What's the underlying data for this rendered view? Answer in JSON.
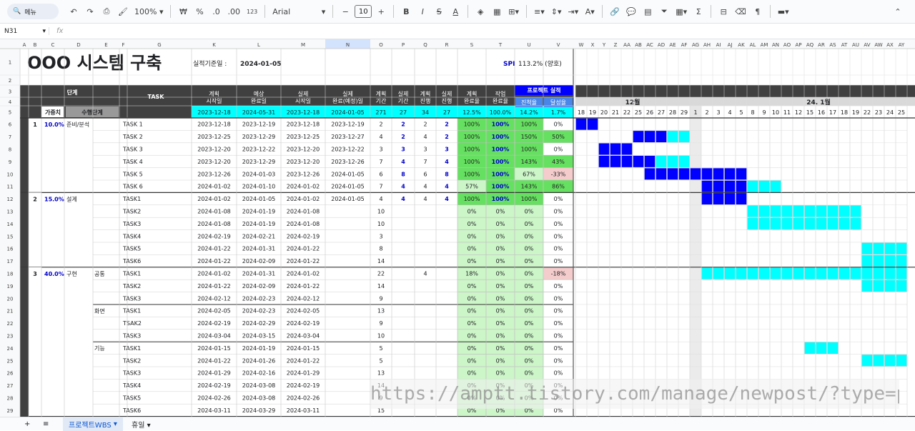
{
  "toolbar": {
    "menu_label": "메뉴",
    "zoom": "100%",
    "currency": "₩",
    "percent": "%",
    "dec_dec": ".0",
    "dec_inc": ".00",
    "number_format": "123",
    "font": "Arial",
    "font_size": "10"
  },
  "namebox": "N31",
  "fx": "fx",
  "title": {
    "main": "OOO 시스템 구축",
    "date_label": "실적기준일 :",
    "date_value": "2024-01-05",
    "spi_label": "SPI",
    "spi_value": "113.2% (양호)"
  },
  "colors": {
    "header_dark": "#404040",
    "cyan": "#00ffff",
    "blue": "#0000ff",
    "green_light": "#ccf5c8",
    "green": "#66e060",
    "pink": "#f4cccc",
    "col_sel": "#d3e3fd"
  },
  "col_letters_left": [
    "A",
    "B",
    "C",
    "D",
    "E",
    "F",
    "G",
    "K",
    "L",
    "M",
    "N",
    "O",
    "P",
    "Q",
    "R",
    "S",
    "T",
    "U",
    "V"
  ],
  "col_letters_right": [
    "W",
    "X",
    "Y",
    "Z",
    "AA",
    "AB",
    "AC",
    "AD",
    "AE",
    "AF",
    "AG",
    "AH",
    "AI",
    "AJ",
    "AK",
    "AL",
    "AM",
    "AN",
    "AO",
    "AP",
    "AQ",
    "AR",
    "AS",
    "AT",
    "AU",
    "AV",
    "AW",
    "AX",
    "AY"
  ],
  "headers": {
    "stage": "단계",
    "weight": "가중치",
    "exec_stage": "수행단계",
    "task": "TASK",
    "plan_start": "계획\n시작일",
    "exp_end": "예상\n완료일",
    "real_start": "실제\n시작일",
    "real_end": "실제\n완료(예정)일",
    "plan_period": "계획\n기간",
    "real_period": "실제\n기간",
    "plan_prog": "계획\n진행",
    "real_prog": "실제\n진행",
    "plan_rate": "계획\n완료율",
    "work_rate": "작업\n완료율",
    "project_perf": "프로젝트 실적",
    "progress_rate": "진척율",
    "achieve_rate": "달성율",
    "month_dec": "12월",
    "month_jan": "24. 1월"
  },
  "summary_row": [
    "2023-12-18",
    "2024-05-31",
    "2023-12-18",
    "2024-01-05",
    "271",
    "27",
    "34",
    "27",
    "12.5%",
    "100.0%",
    "14.2%",
    "1.7%"
  ],
  "days": [
    "18",
    "19",
    "20",
    "21",
    "22",
    "25",
    "26",
    "27",
    "28",
    "29",
    "1",
    "2",
    "3",
    "4",
    "5",
    "8",
    "9",
    "10",
    "11",
    "12",
    "15",
    "16",
    "17",
    "18",
    "19",
    "22",
    "23",
    "24",
    "25"
  ],
  "row_numbers": [
    "1",
    "2",
    "3",
    "4",
    "5",
    "6",
    "7",
    "8",
    "9",
    "10",
    "11",
    "12",
    "13",
    "14",
    "15",
    "16",
    "17",
    "18",
    "19",
    "20",
    "21",
    "22",
    "23",
    "24",
    "25",
    "26",
    "27",
    "28",
    "29"
  ],
  "groups": [
    {
      "num": "1",
      "weight": "10.0%",
      "name": "준비/분석",
      "rows": [
        0,
        5
      ]
    },
    {
      "num": "2",
      "weight": "15.0%",
      "name": "설계",
      "rows": [
        6,
        11
      ]
    },
    {
      "num": "3",
      "weight": "40.0%",
      "name": "구현",
      "rows": [
        12,
        23
      ]
    }
  ],
  "subgroups": [
    {
      "name": "공통",
      "rows": [
        12,
        14
      ]
    },
    {
      "name": "화면",
      "rows": [
        15,
        17
      ]
    },
    {
      "name": "기능",
      "rows": [
        18,
        23
      ]
    }
  ],
  "rows": [
    {
      "task": "TASK 1",
      "ps": "2023-12-18",
      "pe": "2023-12-19",
      "rs": "2023-12-18",
      "re": "2023-12-19",
      "pp": "2",
      "rp": "2",
      "pg": "2",
      "rg": "2",
      "pr": "100%",
      "wr": "100%",
      "prog": "100%",
      "ach": "0%",
      "gantt": [
        {
          "s": 0,
          "e": 2,
          "c": "b"
        }
      ]
    },
    {
      "task": "TASK 2",
      "ps": "2023-12-25",
      "pe": "2023-12-29",
      "rs": "2023-12-25",
      "re": "2023-12-27",
      "pp": "4",
      "rp": "2",
      "pg": "4",
      "rg": "2",
      "pr": "100%",
      "wr": "100%",
      "prog": "150%",
      "ach": "50%",
      "gantt": [
        {
          "s": 5,
          "e": 8,
          "c": "b"
        },
        {
          "s": 8,
          "e": 10,
          "c": "c"
        }
      ]
    },
    {
      "task": "TASK 3",
      "ps": "2023-12-20",
      "pe": "2023-12-22",
      "rs": "2023-12-20",
      "re": "2023-12-22",
      "pp": "3",
      "rp": "3",
      "pg": "3",
      "rg": "3",
      "pr": "100%",
      "wr": "100%",
      "prog": "100%",
      "ach": "0%",
      "gantt": [
        {
          "s": 2,
          "e": 5,
          "c": "b"
        }
      ]
    },
    {
      "task": "TASK 4",
      "ps": "2023-12-20",
      "pe": "2023-12-29",
      "rs": "2023-12-20",
      "re": "2023-12-26",
      "pp": "7",
      "rp": "4",
      "pg": "7",
      "rg": "4",
      "pr": "100%",
      "wr": "100%",
      "prog": "143%",
      "ach": "43%",
      "gantt": [
        {
          "s": 2,
          "e": 7,
          "c": "b"
        },
        {
          "s": 7,
          "e": 10,
          "c": "c"
        }
      ]
    },
    {
      "task": "TASK 5",
      "ps": "2023-12-26",
      "pe": "2024-01-03",
      "rs": "2023-12-26",
      "re": "2024-01-05",
      "pp": "6",
      "rp": "8",
      "pg": "6",
      "rg": "8",
      "pr": "100%",
      "wr": "100%",
      "prog": "67%",
      "ach": "-33%",
      "gantt": [
        {
          "s": 6,
          "e": 15,
          "c": "b"
        }
      ]
    },
    {
      "task": "TASK 6",
      "ps": "2024-01-02",
      "pe": "2024-01-10",
      "rs": "2024-01-02",
      "re": "2024-01-05",
      "pp": "7",
      "rp": "4",
      "pg": "4",
      "rg": "4",
      "pr": "57%",
      "wr": "100%",
      "prog": "143%",
      "ach": "86%",
      "gantt": [
        {
          "s": 11,
          "e": 15,
          "c": "b"
        },
        {
          "s": 15,
          "e": 18,
          "c": "c"
        }
      ]
    },
    {
      "task": "TASK1",
      "ps": "2024-01-02",
      "pe": "2024-01-05",
      "rs": "2024-01-02",
      "re": "2024-01-05",
      "pp": "4",
      "rp": "4",
      "pg": "4",
      "rg": "4",
      "pr": "100%",
      "wr": "100%",
      "prog": "100%",
      "ach": "0%",
      "gantt": [
        {
          "s": 11,
          "e": 15,
          "c": "b"
        }
      ]
    },
    {
      "task": "TASK2",
      "ps": "2024-01-08",
      "pe": "2024-01-19",
      "rs": "2024-01-08",
      "re": "",
      "pp": "10",
      "rp": "",
      "pg": "",
      "rg": "",
      "pr": "0%",
      "wr": "0%",
      "prog": "0%",
      "ach": "0%",
      "gantt": [
        {
          "s": 15,
          "e": 25,
          "c": "c"
        }
      ]
    },
    {
      "task": "TASK3",
      "ps": "2024-01-08",
      "pe": "2024-01-19",
      "rs": "2024-01-08",
      "re": "",
      "pp": "10",
      "rp": "",
      "pg": "",
      "rg": "",
      "pr": "0%",
      "wr": "0%",
      "prog": "0%",
      "ach": "0%",
      "gantt": [
        {
          "s": 15,
          "e": 25,
          "c": "c"
        }
      ]
    },
    {
      "task": "TASK4",
      "ps": "2024-02-19",
      "pe": "2024-02-21",
      "rs": "2024-02-19",
      "re": "",
      "pp": "3",
      "rp": "",
      "pg": "",
      "rg": "",
      "pr": "0%",
      "wr": "0%",
      "prog": "0%",
      "ach": "0%",
      "gantt": []
    },
    {
      "task": "TASK5",
      "ps": "2024-01-22",
      "pe": "2024-01-31",
      "rs": "2024-01-22",
      "re": "",
      "pp": "8",
      "rp": "",
      "pg": "",
      "rg": "",
      "pr": "0%",
      "wr": "0%",
      "prog": "0%",
      "ach": "0%",
      "gantt": [
        {
          "s": 25,
          "e": 29,
          "c": "c"
        }
      ]
    },
    {
      "task": "TASK6",
      "ps": "2024-01-22",
      "pe": "2024-02-09",
      "rs": "2024-01-22",
      "re": "",
      "pp": "14",
      "rp": "",
      "pg": "",
      "rg": "",
      "pr": "0%",
      "wr": "0%",
      "prog": "0%",
      "ach": "0%",
      "gantt": [
        {
          "s": 25,
          "e": 29,
          "c": "c"
        }
      ]
    },
    {
      "task": "TASK1",
      "ps": "2024-01-02",
      "pe": "2024-01-31",
      "rs": "2024-01-02",
      "re": "",
      "pp": "22",
      "rp": "",
      "pg": "4",
      "rg": "",
      "pr": "18%",
      "wr": "0%",
      "prog": "0%",
      "ach": "-18%",
      "gantt": [
        {
          "s": 11,
          "e": 29,
          "c": "c"
        }
      ]
    },
    {
      "task": "TASK2",
      "ps": "2024-01-22",
      "pe": "2024-02-09",
      "rs": "2024-01-22",
      "re": "",
      "pp": "14",
      "rp": "",
      "pg": "",
      "rg": "",
      "pr": "0%",
      "wr": "0%",
      "prog": "0%",
      "ach": "0%",
      "gantt": [
        {
          "s": 25,
          "e": 29,
          "c": "c"
        }
      ]
    },
    {
      "task": "TASK3",
      "ps": "2024-02-12",
      "pe": "2024-02-23",
      "rs": "2024-02-12",
      "re": "",
      "pp": "9",
      "rp": "",
      "pg": "",
      "rg": "",
      "pr": "0%",
      "wr": "0%",
      "prog": "0%",
      "ach": "0%",
      "gantt": []
    },
    {
      "task": "TASK1",
      "ps": "2024-02-05",
      "pe": "2024-02-23",
      "rs": "2024-02-05",
      "re": "",
      "pp": "13",
      "rp": "",
      "pg": "",
      "rg": "",
      "pr": "0%",
      "wr": "0%",
      "prog": "0%",
      "ach": "0%",
      "gantt": []
    },
    {
      "task": "TSAK2",
      "ps": "2024-02-19",
      "pe": "2024-02-29",
      "rs": "2024-02-19",
      "re": "",
      "pp": "9",
      "rp": "",
      "pg": "",
      "rg": "",
      "pr": "0%",
      "wr": "0%",
      "prog": "0%",
      "ach": "0%",
      "gantt": []
    },
    {
      "task": "TASK3",
      "ps": "2024-03-04",
      "pe": "2024-03-15",
      "rs": "2024-03-04",
      "re": "",
      "pp": "10",
      "rp": "",
      "pg": "",
      "rg": "",
      "pr": "0%",
      "wr": "0%",
      "prog": "0%",
      "ach": "0%",
      "gantt": []
    },
    {
      "task": "TASK1",
      "ps": "2024-01-15",
      "pe": "2024-01-19",
      "rs": "2024-01-15",
      "re": "",
      "pp": "5",
      "rp": "",
      "pg": "",
      "rg": "",
      "pr": "0%",
      "wr": "0%",
      "prog": "0%",
      "ach": "0%",
      "gantt": [
        {
          "s": 20,
          "e": 23,
          "c": "c"
        }
      ]
    },
    {
      "task": "TASK2",
      "ps": "2024-01-22",
      "pe": "2024-01-26",
      "rs": "2024-01-22",
      "re": "",
      "pp": "5",
      "rp": "",
      "pg": "",
      "rg": "",
      "pr": "0%",
      "wr": "0%",
      "prog": "0%",
      "ach": "0%",
      "gantt": [
        {
          "s": 25,
          "e": 29,
          "c": "c"
        }
      ]
    },
    {
      "task": "TASK3",
      "ps": "2024-01-29",
      "pe": "2024-02-16",
      "rs": "2024-01-29",
      "re": "",
      "pp": "13",
      "rp": "",
      "pg": "",
      "rg": "",
      "pr": "0%",
      "wr": "0%",
      "prog": "0%",
      "ach": "0%",
      "gantt": []
    },
    {
      "task": "TASK4",
      "ps": "2024-02-19",
      "pe": "2024-03-08",
      "rs": "2024-02-19",
      "re": "",
      "pp": "14",
      "rp": "",
      "pg": "",
      "rg": "",
      "pr": "0%",
      "wr": "0%",
      "prog": "0%",
      "ach": "0%",
      "gantt": []
    },
    {
      "task": "TASK5",
      "ps": "2024-02-26",
      "pe": "2024-03-08",
      "rs": "2024-02-26",
      "re": "",
      "pp": "9",
      "rp": "",
      "pg": "",
      "rg": "",
      "pr": "0%",
      "wr": "0%",
      "prog": "0%",
      "ach": "0%",
      "gantt": []
    },
    {
      "task": "TASK6",
      "ps": "2024-03-11",
      "pe": "2024-03-29",
      "rs": "2024-03-11",
      "re": "",
      "pp": "15",
      "rp": "",
      "pg": "",
      "rg": "",
      "pr": "0%",
      "wr": "0%",
      "prog": "0%",
      "ach": "0%",
      "gantt": []
    }
  ],
  "sheet_tabs": {
    "active": "프로젝트WBS",
    "other": "휴일"
  },
  "watermark": "https://amptt.tistory.com/manage/newpost/?type=post"
}
